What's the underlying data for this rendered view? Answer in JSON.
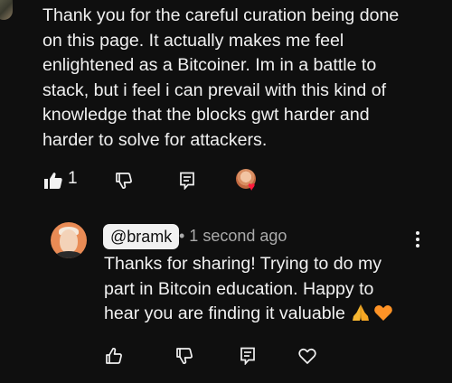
{
  "comment": {
    "lines": [
      "Thank you for the careful curation being done",
      "on this page. It actually makes me feel",
      "enlightened as a Bitcoiner. Im in a battle to",
      "stack, but i feel i can prevail with this kind of",
      "knowledge that the blocks gwt harder and",
      "harder to solve for attackers."
    ],
    "like_count": "1",
    "like_state": "liked"
  },
  "reply": {
    "handle": "@bramk",
    "timestamp": "• 1 second ago",
    "lines": [
      "Thanks for sharing! Trying to do my",
      "part in Bitcoin education. Happy to",
      "hear you are finding it valuable"
    ],
    "emojis": [
      "folded-hands",
      "orange-heart"
    ]
  },
  "colors": {
    "background": "#0f0f0f",
    "text": "#f1f1f1",
    "secondary_text": "#aaaaaa",
    "creator_heart": "#ff1a3c",
    "avatar_orange": "#e98b55"
  }
}
